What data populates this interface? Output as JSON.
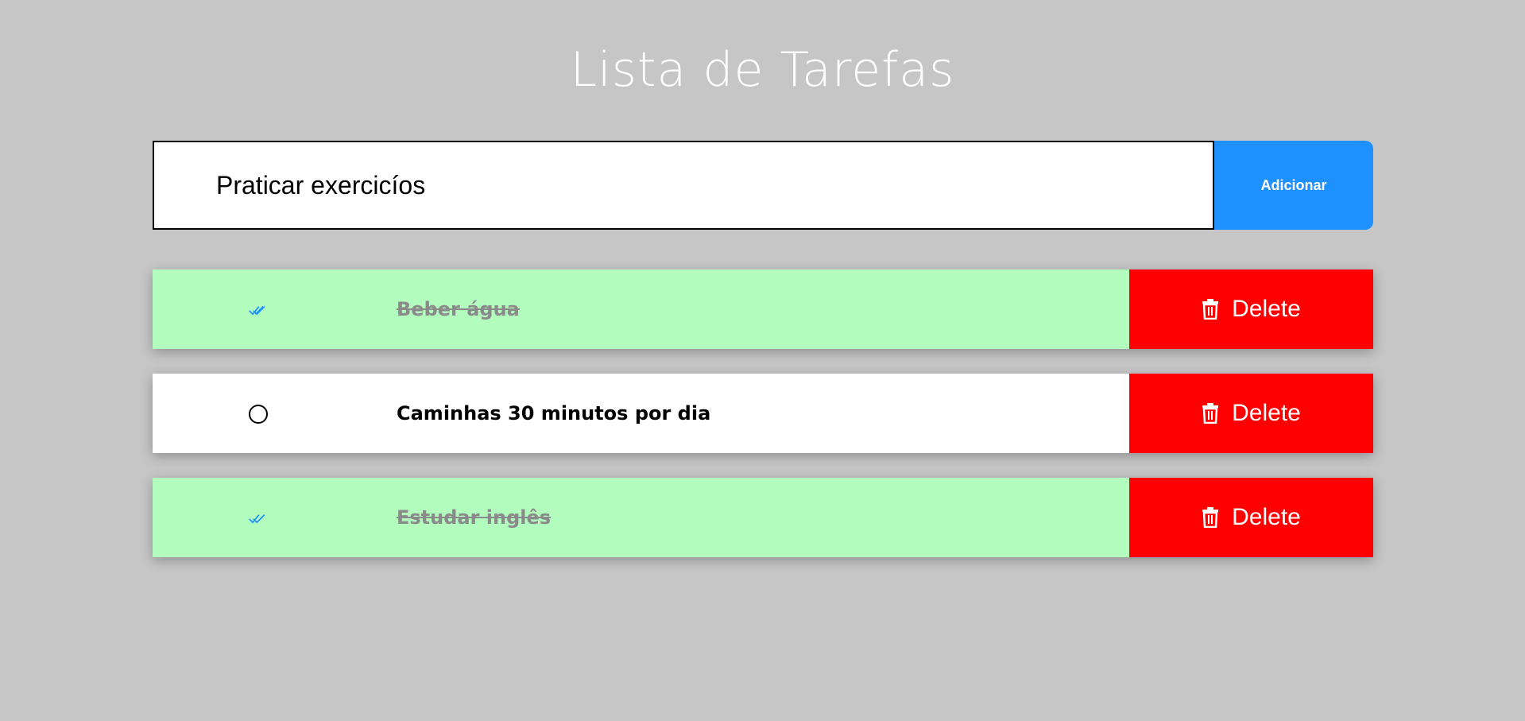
{
  "header": {
    "title": "Lista de Tarefas"
  },
  "form": {
    "input_value": "Praticar exercicíos",
    "add_label": "Adicionar"
  },
  "tasks": [
    {
      "text": "Beber água",
      "done": true,
      "delete_label": "Delete"
    },
    {
      "text": "Caminhas 30 minutos por dia",
      "done": false,
      "delete_label": "Delete"
    },
    {
      "text": "Estudar inglês",
      "done": true,
      "delete_label": "Delete"
    }
  ],
  "colors": {
    "background": "#c6c6c6",
    "accent": "#1e90ff",
    "done_row": "#b2fcbe",
    "delete": "#ff0000"
  },
  "icons": {
    "done": "double-check-icon",
    "pending": "circle-icon",
    "delete": "trash-icon"
  }
}
